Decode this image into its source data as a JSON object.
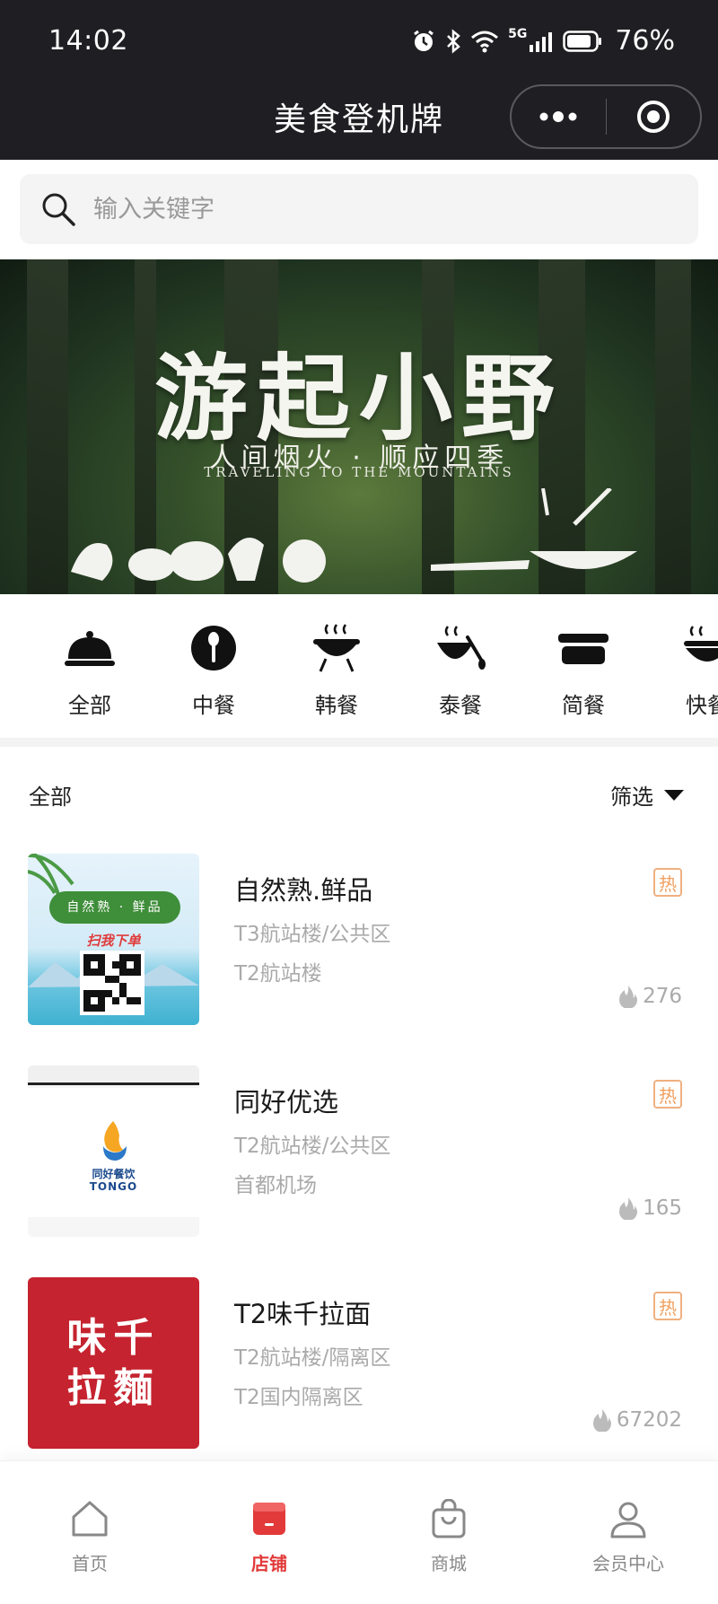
{
  "status_bar": {
    "time": "14:02",
    "network": "5G",
    "battery": "76%"
  },
  "header": {
    "title": "美食登机牌"
  },
  "search": {
    "placeholder": "输入关键字"
  },
  "banner": {
    "title": "游起小野",
    "subtitle": "人间烟火 · 顺应四季",
    "subtitle_en": "TRAVELING TO THE MOUNTAINS"
  },
  "categories": [
    {
      "label": "全部",
      "icon": "cloche-icon"
    },
    {
      "label": "中餐",
      "icon": "spoon-icon"
    },
    {
      "label": "韩餐",
      "icon": "bbq-grill-icon"
    },
    {
      "label": "泰餐",
      "icon": "hot-bowl-icon"
    },
    {
      "label": "简餐",
      "icon": "lunch-box-icon"
    },
    {
      "label": "快餐",
      "icon": "noodle-bowl-icon"
    }
  ],
  "filter": {
    "all_label": "全部",
    "filter_label": "筛选"
  },
  "stores": [
    {
      "name": "自然熟.鲜品",
      "location_1": "T3航站楼/公共区",
      "location_2": "T2航站楼",
      "hot_badge": "热",
      "popularity": "276",
      "thumb_badge": "自然熟 · 鲜品",
      "thumb_slogan": "扫我下单"
    },
    {
      "name": "同好优选",
      "location_1": "T2航站楼/公共区",
      "location_2": "首都机场",
      "hot_badge": "热",
      "popularity": "165",
      "thumb_brand_cn": "同好餐饮",
      "thumb_brand_en": "TONGO"
    },
    {
      "name": "T2味千拉面",
      "location_1": "T2航站楼/隔离区",
      "location_2": "T2国内隔离区",
      "hot_badge": "热",
      "popularity": "67202",
      "thumb_line_1": "味千",
      "thumb_line_2": "拉麵"
    }
  ],
  "tabbar": {
    "items": [
      {
        "label": "首页",
        "icon": "home-icon",
        "active": false
      },
      {
        "label": "店铺",
        "icon": "store-icon",
        "active": true
      },
      {
        "label": "商城",
        "icon": "shopping-bag-icon",
        "active": false
      },
      {
        "label": "会员中心",
        "icon": "user-icon",
        "active": false
      }
    ]
  },
  "colors": {
    "accent": "#e23a3a",
    "header_bg": "#1f1f23",
    "hot_badge": "#f0a060"
  }
}
